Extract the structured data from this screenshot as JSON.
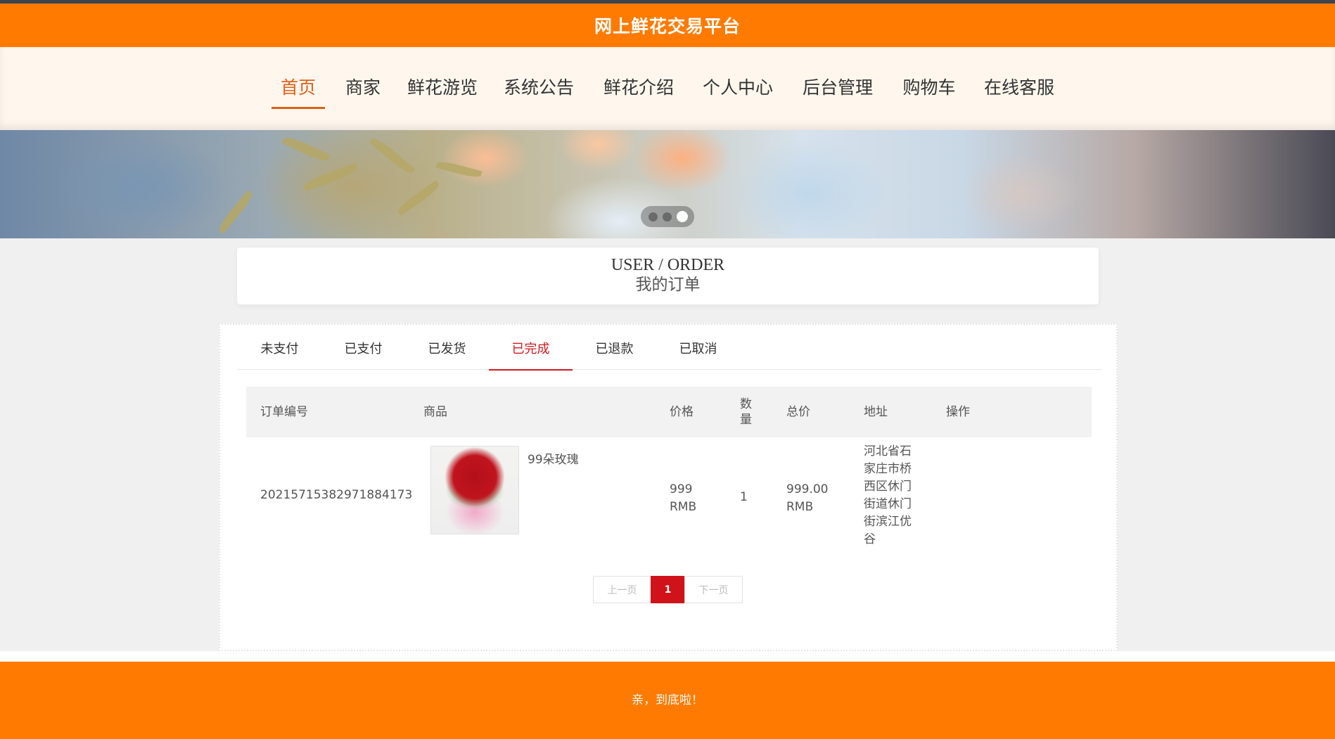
{
  "header": {
    "title": "网上鲜花交易平台"
  },
  "nav": {
    "items": [
      {
        "label": "首页",
        "active": true
      },
      {
        "label": "商家"
      },
      {
        "label": "鲜花游览"
      },
      {
        "label": "系统公告"
      },
      {
        "label": "鲜花介绍"
      },
      {
        "label": "个人中心"
      },
      {
        "label": "后台管理"
      },
      {
        "label": "购物车"
      },
      {
        "label": "在线客服"
      }
    ]
  },
  "banner": {
    "slide_count": 3,
    "active_slide": 3
  },
  "page": {
    "title_en": "USER / ORDER",
    "title_cn": "我的订单"
  },
  "tabs": [
    {
      "label": "未支付"
    },
    {
      "label": "已支付"
    },
    {
      "label": "已发货"
    },
    {
      "label": "已完成",
      "active": true
    },
    {
      "label": "已退款"
    },
    {
      "label": "已取消"
    }
  ],
  "table": {
    "headers": {
      "order_no": "订单编号",
      "goods": "商品",
      "price": "价格",
      "qty": "数量",
      "total": "总价",
      "address": "地址",
      "action": "操作"
    },
    "rows": [
      {
        "order_no": "20215715382971884173",
        "goods_name": "99朵玫瑰",
        "price": "999 RMB",
        "qty": "1",
        "total": "999.00 RMB",
        "address": "河北省石家庄市桥西区休门街道休门街滨江优谷",
        "action": ""
      }
    ]
  },
  "pager": {
    "prev": "上一页",
    "current": "1",
    "next": "下一页"
  },
  "footer": {
    "message": "亲，到底啦！"
  },
  "colors": {
    "brand": "#ff7a00",
    "accent": "#d0191f",
    "nav_active": "#e0601a"
  }
}
